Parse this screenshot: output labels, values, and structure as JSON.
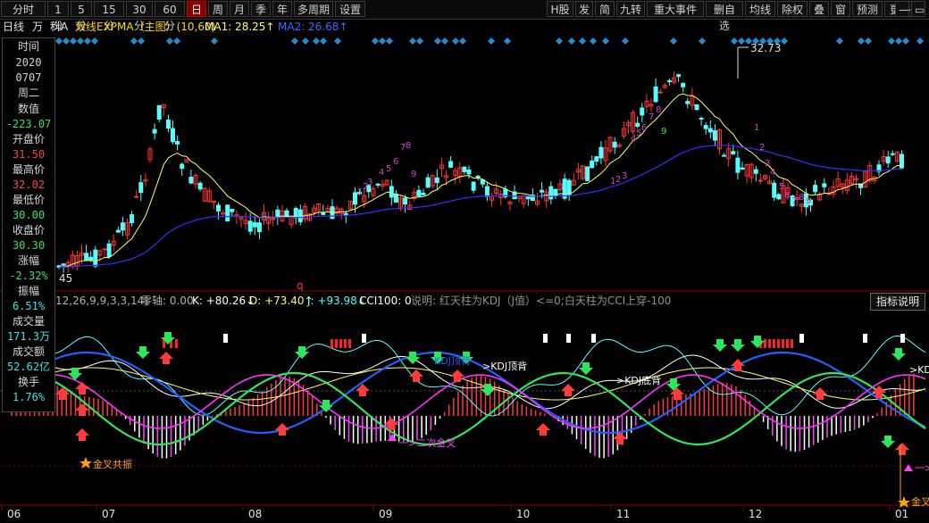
{
  "toolbar": {
    "left_items": [
      "分时",
      "1分",
      "5分",
      "15分",
      "30分",
      "60分",
      "日",
      "周",
      "月",
      "季",
      "年",
      "多周期",
      "设置"
    ],
    "active": "日",
    "right_items": [
      "H股",
      "发",
      "简",
      "九转",
      "重大事件",
      "删自选",
      "均线",
      "除权",
      "叠",
      "窗",
      "预测",
      "更多"
    ]
  },
  "titlebar": {
    "period": "日线",
    "unit": "万",
    "flags": "科A",
    "indicator": "双线EXPMA（主图）(10,60)",
    "ma1": "MA1: 28.25↑",
    "ma2": "MA2: 26.68↑"
  },
  "infobox": {
    "rows": [
      {
        "label": "时间",
        "value": "2020",
        "value2": "0707",
        "value3": "周二"
      },
      {
        "label": "数值",
        "value": "-223.07",
        "color": "#2ee65a"
      },
      {
        "label": "开盘价",
        "value": "31.50",
        "color": "#ff4040"
      },
      {
        "label": "最高价",
        "value": "32.02",
        "color": "#ff4040"
      },
      {
        "label": "最低价",
        "value": "30.00",
        "color": "#2ee65a"
      },
      {
        "label": "收盘价",
        "value": "30.30",
        "color": "#2ee65a"
      },
      {
        "label": "涨幅",
        "value": "-2.32%",
        "color": "#2ee65a"
      },
      {
        "label": "振幅",
        "value": "6.51%",
        "color": "#2ee6e6"
      },
      {
        "label": "成交量",
        "value": "171.3万",
        "color": "#2ee6e6"
      },
      {
        "label": "成交额",
        "value": "52.62亿",
        "color": "#2ee6e6"
      },
      {
        "label": "换手",
        "value": "1.76%",
        "color": "#2ee6e6"
      }
    ]
  },
  "price_chart": {
    "high_label": "32.73",
    "low_label": "45",
    "seq_up": [
      "1",
      "2",
      "3",
      "4",
      "5",
      "6",
      "7",
      "8",
      "9"
    ],
    "seq_down": [
      "1",
      "2",
      "3",
      "4",
      "5",
      "6",
      "7",
      "8",
      "9"
    ],
    "marker_q": "q"
  },
  "indicator": {
    "params": "12,26,9,9,3,3,14)",
    "zero": "零轴: 0.00",
    "k": "K: +80.26↓",
    "d": "D: +73.40↑",
    "j": "J: +93.98↓",
    "cci": "CCI100: 0",
    "note": "说明: 红天柱为KDJ（J值）<=0;白天柱为CCI上穿-100",
    "button": "指标说明",
    "annotations": [
      "金叉共振",
      "二次金叉",
      "KDJ顶背",
      "KDJ顶背",
      "KDJ底背",
      "KDJ",
      "金叉",
      "一>"
    ]
  },
  "xaxis": {
    "labels": [
      "06",
      "07",
      "08",
      "09",
      "10",
      "11",
      "12",
      "01"
    ]
  },
  "colors": {
    "up": "#ff3232",
    "down": "#54ffff",
    "ma1": "#ffff64",
    "ma2": "#3030ff",
    "green": "#2ee65a"
  }
}
